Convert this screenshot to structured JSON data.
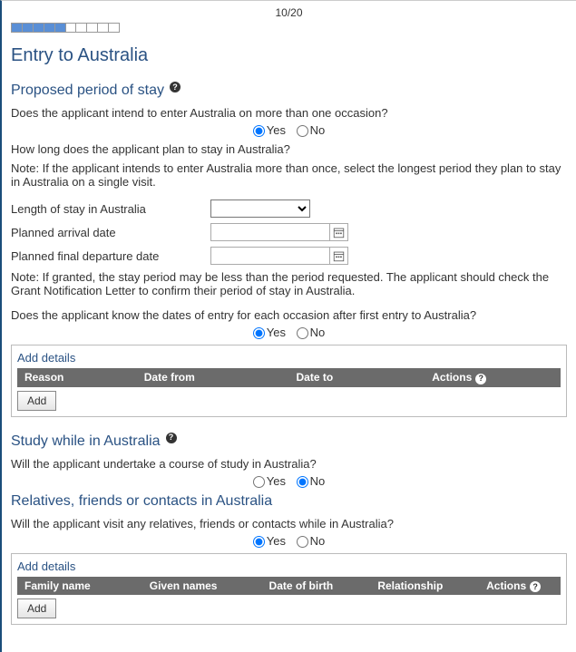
{
  "pager": "10/20",
  "page_title": "Entry to Australia",
  "sections": {
    "proposed": {
      "heading": "Proposed period of stay",
      "q_multi_occasion": "Does the applicant intend to enter Australia on more than one occasion?",
      "yes": "Yes",
      "no": "No",
      "q_how_long": "How long does the applicant plan to stay in Australia?",
      "note1": "Note: If the applicant intends to enter Australia more than once, select the longest period they plan to stay in Australia on a single visit.",
      "length_label": "Length of stay in Australia",
      "arrival_label": "Planned arrival date",
      "departure_label": "Planned final departure date",
      "note2": "Note: If granted, the stay period may be less than the period requested. The applicant should check the Grant Notification Letter to confirm their period of stay in Australia.",
      "q_know_dates": "Does the applicant know the dates of entry for each occasion after first entry to Australia?",
      "details_title": "Add details",
      "cols": {
        "reason": "Reason",
        "date_from": "Date from",
        "date_to": "Date to",
        "actions": "Actions"
      },
      "add_btn": "Add"
    },
    "study": {
      "heading": "Study while in Australia",
      "q_study": "Will the applicant undertake a course of study in Australia?",
      "yes": "Yes",
      "no": "No"
    },
    "relatives": {
      "heading": "Relatives, friends or contacts in Australia",
      "q_visit": "Will the applicant visit any relatives, friends or contacts while in Australia?",
      "yes": "Yes",
      "no": "No",
      "details_title": "Add details",
      "cols": {
        "family": "Family name",
        "given": "Given names",
        "dob": "Date of birth",
        "rel": "Relationship",
        "actions": "Actions"
      },
      "add_btn": "Add"
    }
  },
  "state": {
    "multi_occasion": "Yes",
    "know_dates": "Yes",
    "study": "No",
    "visit_relatives": "Yes"
  }
}
